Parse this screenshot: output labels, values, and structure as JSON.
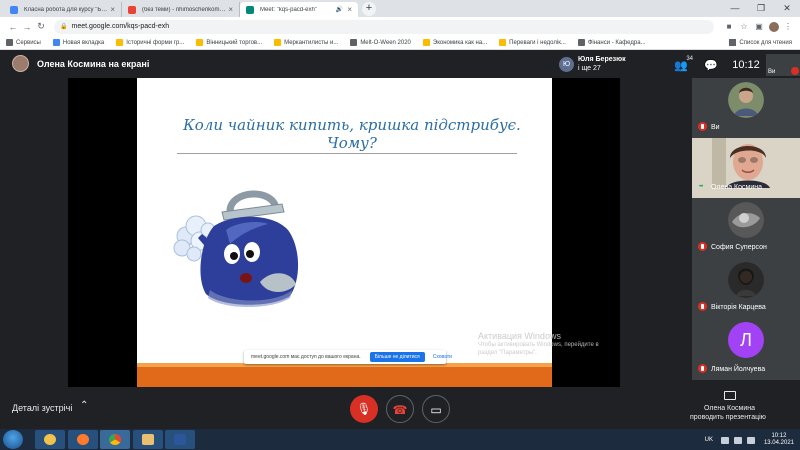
{
  "browser": {
    "tabs": [
      {
        "title": "Класна робота для курсу \"Банк",
        "extra": "",
        "color": "#4285f4",
        "active": false
      },
      {
        "title": "(без теми) - nhimoschenkom@g",
        "extra": "",
        "color": "#ea4335",
        "active": false
      },
      {
        "title": "Meet: \"kqs-pacd-exh\"",
        "extra": "🔊",
        "color": "#00897b",
        "active": true
      }
    ],
    "new_tab": "+",
    "window_controls": [
      "—",
      "❐",
      "✕"
    ],
    "url": "meet.google.com/kqs-pacd-exh",
    "bookmarks": [
      {
        "label": "Сервисы",
        "color": "#5f6368"
      },
      {
        "label": "Новая вкладка",
        "color": "#4285f4"
      },
      {
        "label": "Історичні форми гр...",
        "color": "#fbbc04"
      },
      {
        "label": "Вінницький торгов...",
        "color": "#fbbc04"
      },
      {
        "label": "Меркантилисты и...",
        "color": "#fbbc04"
      },
      {
        "label": "Melt-O-Ween 2020",
        "color": "#5f6368"
      },
      {
        "label": "Экономика как на...",
        "color": "#fbbc04"
      },
      {
        "label": "Переваги і недолік...",
        "color": "#fbbc04"
      },
      {
        "label": "Фінанси - Кафедра...",
        "color": "#5f6368"
      }
    ],
    "reading_list": "Список для чтения"
  },
  "meet": {
    "presenter_label": "Олена Космина на екрані",
    "participant_card": {
      "initial": "Ю",
      "name": "Юля Березюк",
      "more": "і ще 27"
    },
    "participants_count": "34",
    "time": "10:12",
    "self_label": "Ви",
    "tiles": [
      {
        "name": "Ви",
        "mic_muted": true
      },
      {
        "name": "Олена Космина",
        "mic_muted": false
      },
      {
        "name": "София Суперсон",
        "mic_muted": true
      },
      {
        "name": "Вікторія Карцева",
        "mic_muted": true
      },
      {
        "name": "Ляман Йолчуева",
        "mic_muted": true,
        "initial": "Л"
      }
    ],
    "details_label": "Деталі зустрічі",
    "presenting_name": "Олена Космина",
    "presenting_sub": "проводить презентацію"
  },
  "slide": {
    "title_line1": "Коли чайник кипить, кришка підстрибує.",
    "title_line2": "Чому?"
  },
  "share_bar": {
    "text": "meet.google.com має доступ до вашого екрана.",
    "stop": "Більше не ділитися",
    "hide": "Сховати"
  },
  "watermark": {
    "title": "Активация Windows",
    "sub": "Чтобы активировать Windows, перейдите в раздел \"Параметры\"."
  },
  "taskbar": {
    "lang": "UK",
    "time": "10:12",
    "date": "13.04.2021"
  },
  "colors": {
    "accent": "#1a73e8",
    "mic_off": "#d93025",
    "slide_title": "#2a6ea6",
    "slide_band": "#e06a1a"
  }
}
